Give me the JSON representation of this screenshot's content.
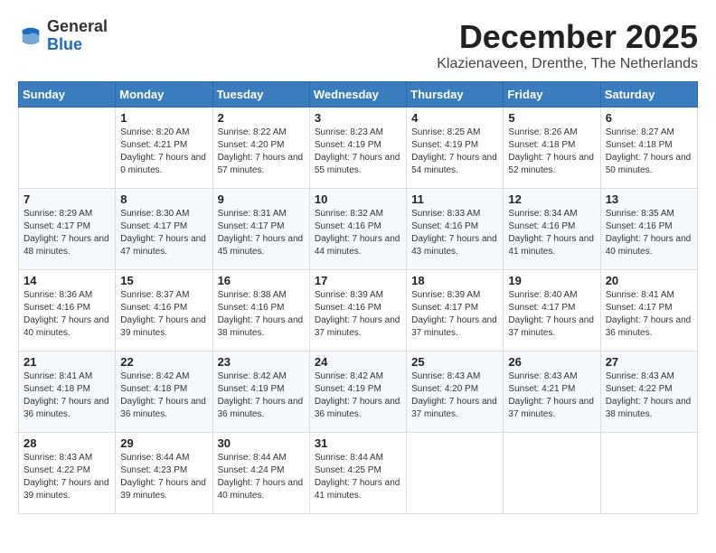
{
  "logo": {
    "general": "General",
    "blue": "Blue"
  },
  "header": {
    "month": "December 2025",
    "location": "Klazienaveen, Drenthe, The Netherlands"
  },
  "weekdays": [
    "Sunday",
    "Monday",
    "Tuesday",
    "Wednesday",
    "Thursday",
    "Friday",
    "Saturday"
  ],
  "weeks": [
    [
      {
        "day": "",
        "sunrise": "",
        "sunset": "",
        "daylight": ""
      },
      {
        "day": "1",
        "sunrise": "Sunrise: 8:20 AM",
        "sunset": "Sunset: 4:21 PM",
        "daylight": "Daylight: 7 hours and 0 minutes."
      },
      {
        "day": "2",
        "sunrise": "Sunrise: 8:22 AM",
        "sunset": "Sunset: 4:20 PM",
        "daylight": "Daylight: 7 hours and 57 minutes."
      },
      {
        "day": "3",
        "sunrise": "Sunrise: 8:23 AM",
        "sunset": "Sunset: 4:19 PM",
        "daylight": "Daylight: 7 hours and 55 minutes."
      },
      {
        "day": "4",
        "sunrise": "Sunrise: 8:25 AM",
        "sunset": "Sunset: 4:19 PM",
        "daylight": "Daylight: 7 hours and 54 minutes."
      },
      {
        "day": "5",
        "sunrise": "Sunrise: 8:26 AM",
        "sunset": "Sunset: 4:18 PM",
        "daylight": "Daylight: 7 hours and 52 minutes."
      },
      {
        "day": "6",
        "sunrise": "Sunrise: 8:27 AM",
        "sunset": "Sunset: 4:18 PM",
        "daylight": "Daylight: 7 hours and 50 minutes."
      }
    ],
    [
      {
        "day": "7",
        "sunrise": "Sunrise: 8:29 AM",
        "sunset": "Sunset: 4:17 PM",
        "daylight": "Daylight: 7 hours and 48 minutes."
      },
      {
        "day": "8",
        "sunrise": "Sunrise: 8:30 AM",
        "sunset": "Sunset: 4:17 PM",
        "daylight": "Daylight: 7 hours and 47 minutes."
      },
      {
        "day": "9",
        "sunrise": "Sunrise: 8:31 AM",
        "sunset": "Sunset: 4:17 PM",
        "daylight": "Daylight: 7 hours and 45 minutes."
      },
      {
        "day": "10",
        "sunrise": "Sunrise: 8:32 AM",
        "sunset": "Sunset: 4:16 PM",
        "daylight": "Daylight: 7 hours and 44 minutes."
      },
      {
        "day": "11",
        "sunrise": "Sunrise: 8:33 AM",
        "sunset": "Sunset: 4:16 PM",
        "daylight": "Daylight: 7 hours and 43 minutes."
      },
      {
        "day": "12",
        "sunrise": "Sunrise: 8:34 AM",
        "sunset": "Sunset: 4:16 PM",
        "daylight": "Daylight: 7 hours and 41 minutes."
      },
      {
        "day": "13",
        "sunrise": "Sunrise: 8:35 AM",
        "sunset": "Sunset: 4:16 PM",
        "daylight": "Daylight: 7 hours and 40 minutes."
      }
    ],
    [
      {
        "day": "14",
        "sunrise": "Sunrise: 8:36 AM",
        "sunset": "Sunset: 4:16 PM",
        "daylight": "Daylight: 7 hours and 40 minutes."
      },
      {
        "day": "15",
        "sunrise": "Sunrise: 8:37 AM",
        "sunset": "Sunset: 4:16 PM",
        "daylight": "Daylight: 7 hours and 39 minutes."
      },
      {
        "day": "16",
        "sunrise": "Sunrise: 8:38 AM",
        "sunset": "Sunset: 4:16 PM",
        "daylight": "Daylight: 7 hours and 38 minutes."
      },
      {
        "day": "17",
        "sunrise": "Sunrise: 8:39 AM",
        "sunset": "Sunset: 4:16 PM",
        "daylight": "Daylight: 7 hours and 37 minutes."
      },
      {
        "day": "18",
        "sunrise": "Sunrise: 8:39 AM",
        "sunset": "Sunset: 4:17 PM",
        "daylight": "Daylight: 7 hours and 37 minutes."
      },
      {
        "day": "19",
        "sunrise": "Sunrise: 8:40 AM",
        "sunset": "Sunset: 4:17 PM",
        "daylight": "Daylight: 7 hours and 37 minutes."
      },
      {
        "day": "20",
        "sunrise": "Sunrise: 8:41 AM",
        "sunset": "Sunset: 4:17 PM",
        "daylight": "Daylight: 7 hours and 36 minutes."
      }
    ],
    [
      {
        "day": "21",
        "sunrise": "Sunrise: 8:41 AM",
        "sunset": "Sunset: 4:18 PM",
        "daylight": "Daylight: 7 hours and 36 minutes."
      },
      {
        "day": "22",
        "sunrise": "Sunrise: 8:42 AM",
        "sunset": "Sunset: 4:18 PM",
        "daylight": "Daylight: 7 hours and 36 minutes."
      },
      {
        "day": "23",
        "sunrise": "Sunrise: 8:42 AM",
        "sunset": "Sunset: 4:19 PM",
        "daylight": "Daylight: 7 hours and 36 minutes."
      },
      {
        "day": "24",
        "sunrise": "Sunrise: 8:42 AM",
        "sunset": "Sunset: 4:19 PM",
        "daylight": "Daylight: 7 hours and 36 minutes."
      },
      {
        "day": "25",
        "sunrise": "Sunrise: 8:43 AM",
        "sunset": "Sunset: 4:20 PM",
        "daylight": "Daylight: 7 hours and 37 minutes."
      },
      {
        "day": "26",
        "sunrise": "Sunrise: 8:43 AM",
        "sunset": "Sunset: 4:21 PM",
        "daylight": "Daylight: 7 hours and 37 minutes."
      },
      {
        "day": "27",
        "sunrise": "Sunrise: 8:43 AM",
        "sunset": "Sunset: 4:22 PM",
        "daylight": "Daylight: 7 hours and 38 minutes."
      }
    ],
    [
      {
        "day": "28",
        "sunrise": "Sunrise: 8:43 AM",
        "sunset": "Sunset: 4:22 PM",
        "daylight": "Daylight: 7 hours and 39 minutes."
      },
      {
        "day": "29",
        "sunrise": "Sunrise: 8:44 AM",
        "sunset": "Sunset: 4:23 PM",
        "daylight": "Daylight: 7 hours and 39 minutes."
      },
      {
        "day": "30",
        "sunrise": "Sunrise: 8:44 AM",
        "sunset": "Sunset: 4:24 PM",
        "daylight": "Daylight: 7 hours and 40 minutes."
      },
      {
        "day": "31",
        "sunrise": "Sunrise: 8:44 AM",
        "sunset": "Sunset: 4:25 PM",
        "daylight": "Daylight: 7 hours and 41 minutes."
      },
      {
        "day": "",
        "sunrise": "",
        "sunset": "",
        "daylight": ""
      },
      {
        "day": "",
        "sunrise": "",
        "sunset": "",
        "daylight": ""
      },
      {
        "day": "",
        "sunrise": "",
        "sunset": "",
        "daylight": ""
      }
    ]
  ]
}
